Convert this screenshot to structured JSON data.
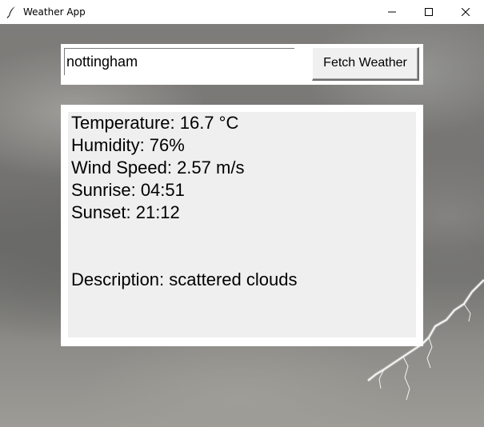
{
  "window": {
    "title": "Weather App",
    "app_icon": "feather-icon",
    "controls": [
      "minimize-icon",
      "maximize-icon",
      "close-icon"
    ]
  },
  "search": {
    "city_value": "nottingham",
    "button_label": "Fetch Weather"
  },
  "weather": {
    "temperature": "Temperature: 16.7 °C",
    "humidity": "Humidity: 76%",
    "wind_speed": "Wind Speed: 2.57 m/s",
    "sunrise": "Sunrise: 04:51",
    "sunset": "Sunset: 21:12",
    "description": "Description: scattered clouds"
  },
  "background": "stormy-sky-with-lightning",
  "colors": {
    "panel_bg": "#efefef",
    "button_bg": "#f0f0f0",
    "frame_bg": "#ffffff"
  }
}
